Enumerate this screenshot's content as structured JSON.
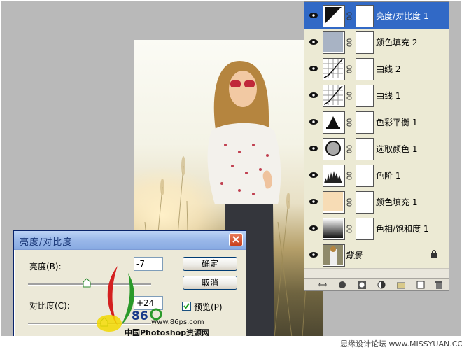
{
  "layers": [
    {
      "name": "亮度/对比度 1",
      "active": true,
      "thumb_icon": "brightness-contrast-icon"
    },
    {
      "name": "颜色填充 2",
      "active": false,
      "thumb_icon": "solid-fill-icon",
      "fill": "#a8b3c4"
    },
    {
      "name": "曲线 2",
      "active": false,
      "thumb_icon": "curves-icon"
    },
    {
      "name": "曲线 1",
      "active": false,
      "thumb_icon": "curves-icon"
    },
    {
      "name": "色彩平衡 1",
      "active": false,
      "thumb_icon": "color-balance-icon"
    },
    {
      "name": "选取颜色 1",
      "active": false,
      "thumb_icon": "selective-color-icon"
    },
    {
      "name": "色阶 1",
      "active": false,
      "thumb_icon": "levels-icon"
    },
    {
      "name": "颜色填充 1",
      "active": false,
      "thumb_icon": "solid-fill-icon",
      "fill": "#f7dcb5"
    },
    {
      "name": "色相/饱和度 1",
      "active": false,
      "thumb_icon": "hue-saturation-icon"
    },
    {
      "name": "背景",
      "active": false,
      "thumb_icon": "photo-thumbnail"
    }
  ],
  "dialog": {
    "title": "亮度/对比度",
    "brightness_label": "亮度(B):",
    "brightness_value": "-7",
    "brightness_level": 0.48,
    "contrast_label": "对比度(C):",
    "contrast_value": "+24",
    "contrast_level": 0.62,
    "ok_label": "确定",
    "cancel_label": "取消",
    "preview_label": "预览(P)",
    "preview_checked": true
  },
  "watermark": {
    "number": "86",
    "url": "www.86ps.com",
    "site": "中国Photoshop资源网"
  },
  "footer": "思缘设计论坛  www.MISSYUAN.COM",
  "colors": {
    "active_layer": "#3169c6",
    "dialog_title": "#9ab8e9",
    "workspace": "#b9b9b9"
  }
}
